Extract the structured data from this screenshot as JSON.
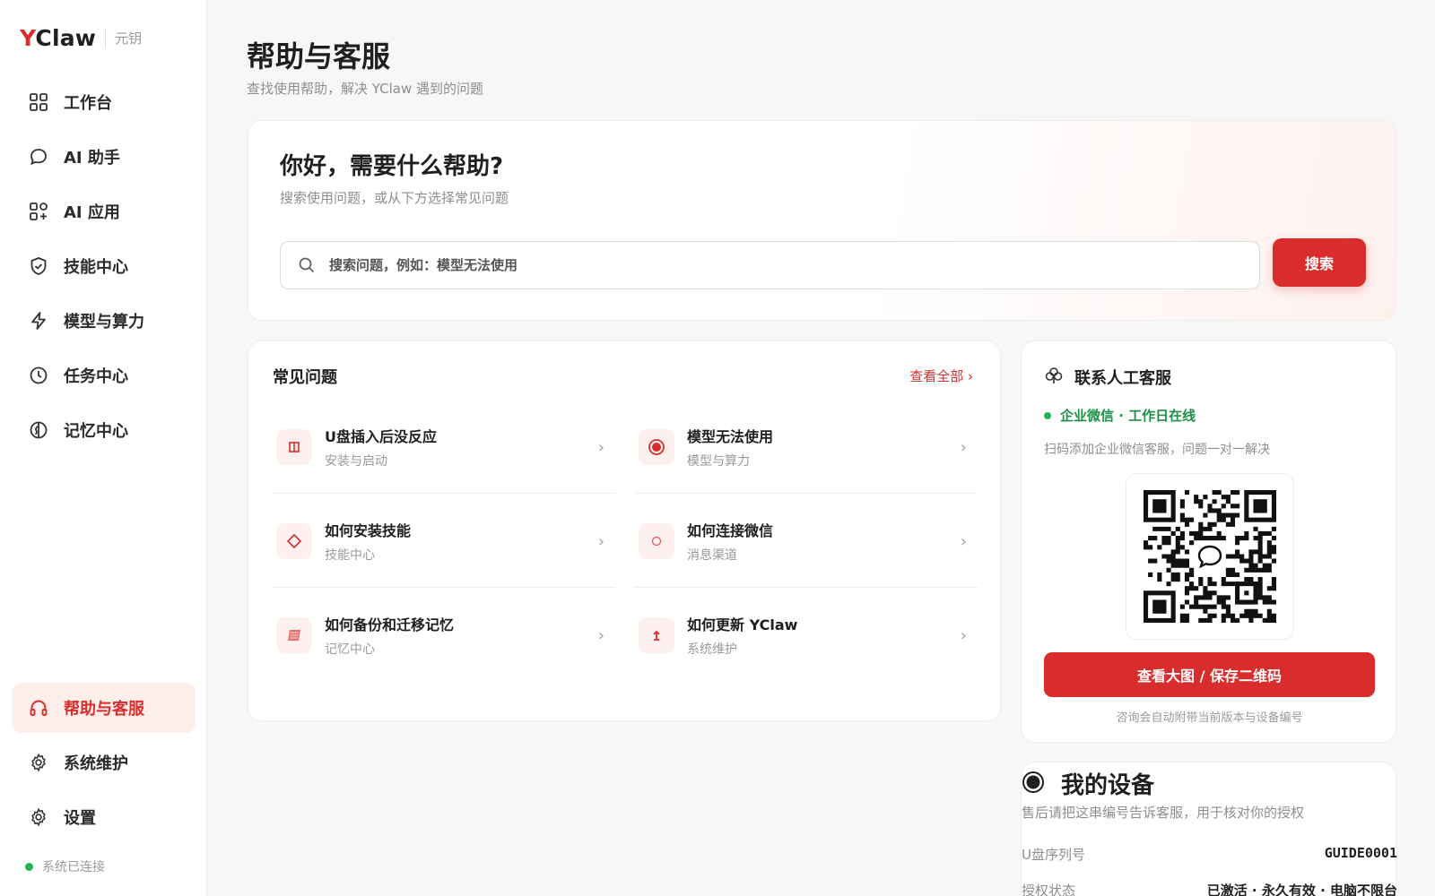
{
  "brand": {
    "logo_y": "Y",
    "logo_rest": "Claw",
    "subtitle": "元钥"
  },
  "sidebar": {
    "items": [
      {
        "label": "工作台",
        "icon": "grid-icon"
      },
      {
        "label": "AI 助手",
        "icon": "chat-bubble-icon"
      },
      {
        "label": "AI 应用",
        "icon": "apps-icon"
      },
      {
        "label": "技能中心",
        "icon": "shield-check-icon"
      },
      {
        "label": "模型与算力",
        "icon": "lightning-icon"
      },
      {
        "label": "任务中心",
        "icon": "clock-icon"
      },
      {
        "label": "记忆中心",
        "icon": "brain-icon"
      }
    ],
    "bottom_items": [
      {
        "label": "帮助与客服",
        "icon": "headphones-icon",
        "active": true
      },
      {
        "label": "系统维护",
        "icon": "gear-icon"
      },
      {
        "label": "设置",
        "icon": "settings-icon"
      }
    ],
    "status": "系统已连接"
  },
  "header": {
    "title": "帮助与客服",
    "subtitle": "查找使用帮助，解决 YClaw 遇到的问题"
  },
  "search": {
    "title": "你好，需要什么帮助?",
    "subtitle": "搜索使用问题，或从下方选择常见问题",
    "placeholder": "搜索问题，例如：模型无法使用",
    "button": "搜索"
  },
  "faq": {
    "title": "常见问题",
    "view_all": "查看全部 ›",
    "items": [
      {
        "question": "U盘插入后没反应",
        "category": "安装与启动",
        "icon": "usb-drive-icon"
      },
      {
        "question": "模型无法使用",
        "category": "模型与算力",
        "icon": "target-icon"
      },
      {
        "question": "如何安装技能",
        "category": "技能中心",
        "icon": "diamond-icon"
      },
      {
        "question": "如何连接微信",
        "category": "消息渠道",
        "icon": "circle-icon"
      },
      {
        "question": "如何备份和迁移记忆",
        "category": "记忆中心",
        "icon": "notebook-icon"
      },
      {
        "question": "如何更新 YClaw",
        "category": "系统维护",
        "icon": "upload-icon"
      }
    ],
    "arrow": "›"
  },
  "contact": {
    "title": "联系人工客服",
    "online": "企业微信 · 工作日在线",
    "desc": "扫码添加企业微信客服，问题一对一解决",
    "button": "查看大图 / 保存二维码",
    "note": "咨询会自动附带当前版本与设备编号"
  },
  "device": {
    "title": "我的设备",
    "desc": "售后请把这串编号告诉客服，用于核对你的授权",
    "serial_label": "U盘序列号",
    "serial_value": "GUIDE0001",
    "auth_label": "授权状态",
    "auth_value": "已激活 · 永久有效 · 电脑不限台"
  },
  "colors": {
    "accent": "#d92d2d",
    "online": "#22b455",
    "active_bg": "#fdeeea"
  }
}
